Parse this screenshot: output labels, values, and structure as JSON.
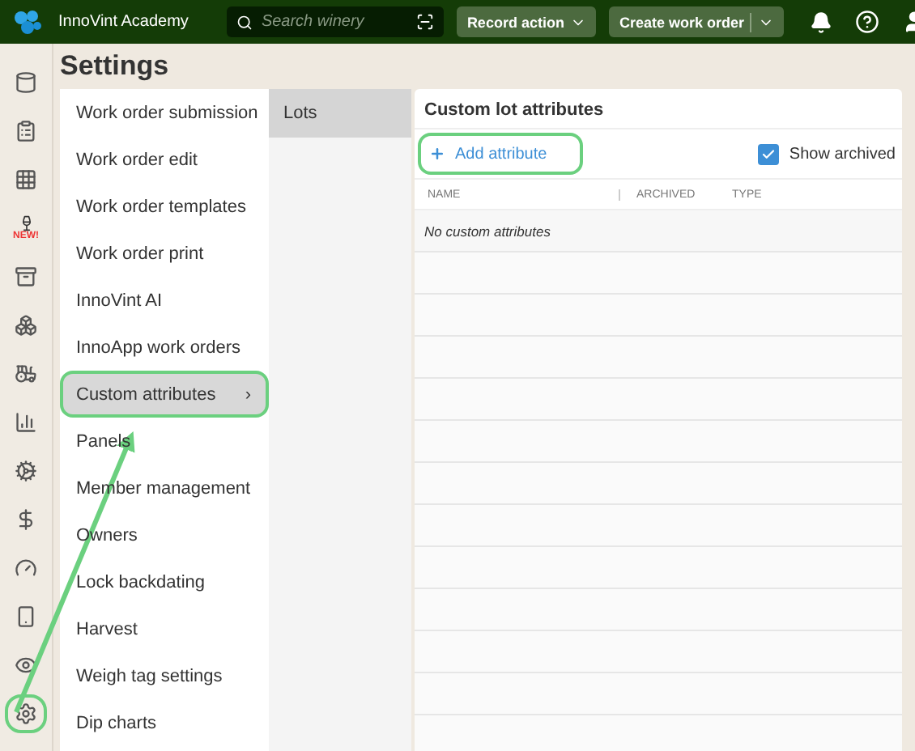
{
  "topbar": {
    "org": "InnoVint Academy",
    "search": {
      "placeholder": "Search winery"
    },
    "record_action": "Record action",
    "create_work_order": "Create work order"
  },
  "rail": [
    {
      "highlighted": false
    },
    {
      "highlighted": false
    },
    {
      "highlighted": false
    },
    {
      "badge": "NEW!",
      "highlighted": false
    },
    {
      "highlighted": false
    },
    {
      "highlighted": false
    },
    {
      "highlighted": false
    },
    {
      "highlighted": false
    },
    {
      "highlighted": false
    },
    {
      "highlighted": false
    },
    {
      "highlighted": false
    },
    {
      "highlighted": false
    },
    {
      "highlighted": false
    },
    {
      "highlighted": true
    }
  ],
  "page_title": "Settings",
  "menu": [
    {
      "label": "Work order submission",
      "selected": false,
      "highlighted": false
    },
    {
      "label": "Work order edit",
      "selected": false,
      "highlighted": false
    },
    {
      "label": "Work order templates",
      "selected": false,
      "highlighted": false
    },
    {
      "label": "Work order print",
      "selected": false,
      "highlighted": false
    },
    {
      "label": "InnoVint AI",
      "selected": false,
      "highlighted": false
    },
    {
      "label": "InnoApp work orders",
      "selected": false,
      "highlighted": false
    },
    {
      "label": "Custom attributes",
      "selected": true,
      "highlighted": true,
      "chevron": "›"
    },
    {
      "label": "Panels",
      "selected": false,
      "highlighted": false
    },
    {
      "label": "Member management",
      "selected": false,
      "highlighted": false
    },
    {
      "label": "Owners",
      "selected": false,
      "highlighted": false
    },
    {
      "label": "Lock backdating",
      "selected": false,
      "highlighted": false
    },
    {
      "label": "Harvest",
      "selected": false,
      "highlighted": false
    },
    {
      "label": "Weigh tag settings",
      "selected": false,
      "highlighted": false
    },
    {
      "label": "Dip charts",
      "selected": false,
      "highlighted": false
    }
  ],
  "submenu": [
    {
      "label": "Lots",
      "selected": true
    }
  ],
  "panel": {
    "title": "Custom lot attributes",
    "add_button": {
      "label": "Add attribute",
      "highlighted": true
    },
    "show_archived": {
      "label": "Show archived",
      "checked": true
    },
    "columns": [
      "NAME",
      "ARCHIVED",
      "TYPE"
    ],
    "empty_message": "No custom attributes"
  }
}
